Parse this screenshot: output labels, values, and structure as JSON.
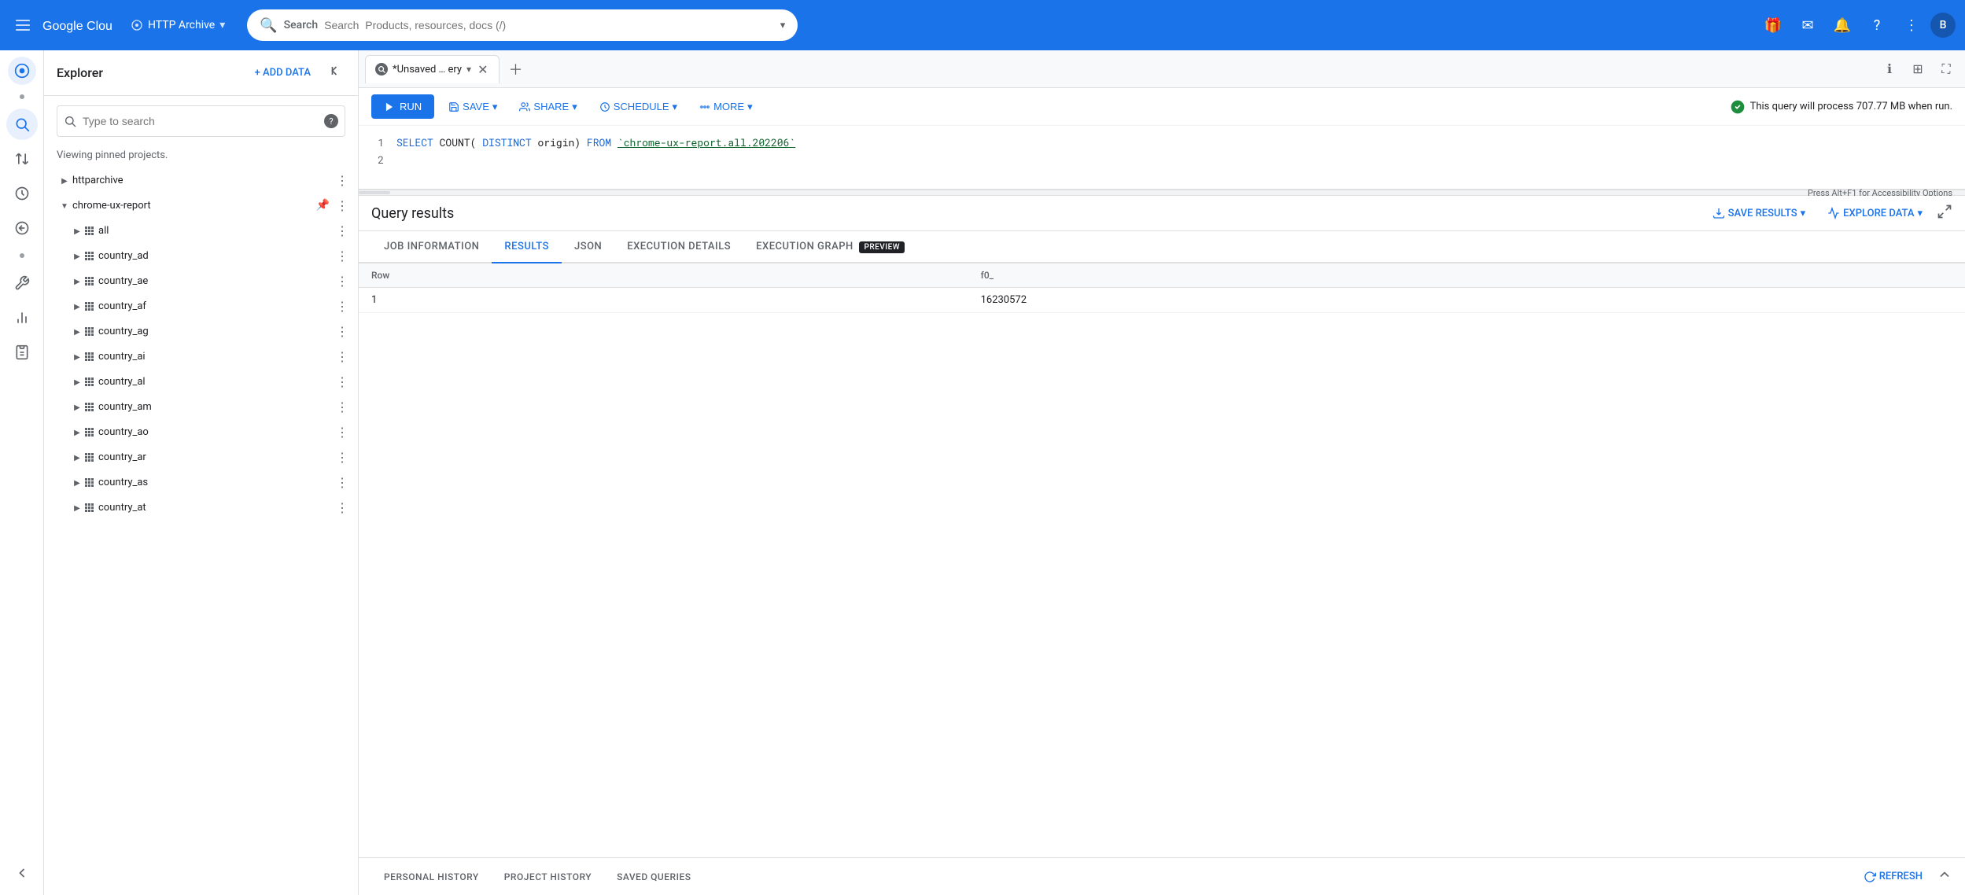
{
  "topnav": {
    "hamburger_label": "☰",
    "logo_text": "Google Cloud",
    "project_name": "HTTP Archive",
    "search_placeholder": "Search  Products, resources, docs (/)",
    "icons": [
      "🎁",
      "✉",
      "🔔",
      "?",
      "⋮"
    ],
    "avatar_letter": "B"
  },
  "icon_sidebar": {
    "items": [
      {
        "icon": "⊙",
        "name": "analytics-icon",
        "active": true
      },
      {
        "icon": "⇅",
        "name": "transfer-icon",
        "active": false
      },
      {
        "icon": "🕐",
        "name": "history-icon",
        "active": false
      },
      {
        "icon": "⚙",
        "name": "refresh-icon2",
        "active": false
      },
      {
        "icon": "🔧",
        "name": "tools-icon",
        "active": false
      },
      {
        "icon": "📊",
        "name": "chart-icon",
        "active": false
      },
      {
        "icon": "📋",
        "name": "clipboard-icon",
        "active": false
      }
    ],
    "expand_label": "‹"
  },
  "explorer": {
    "title": "Explorer",
    "add_data_label": "+ ADD DATA",
    "collapse_icon": "◁",
    "search_placeholder": "Type to search",
    "search_help": "?",
    "viewing_text": "Viewing pinned projects.",
    "tree": [
      {
        "id": "httparchive",
        "label": "httparchive",
        "level": 0,
        "expanded": false,
        "has_children": true,
        "pinned": false
      },
      {
        "id": "chrome-ux-report",
        "label": "chrome-ux-report",
        "level": 0,
        "expanded": true,
        "has_children": true,
        "pinned": true
      },
      {
        "id": "all",
        "label": "all",
        "level": 1,
        "expanded": false,
        "has_children": true,
        "pinned": false
      },
      {
        "id": "country_ad",
        "label": "country_ad",
        "level": 1,
        "expanded": false,
        "has_children": true,
        "pinned": false
      },
      {
        "id": "country_ae",
        "label": "country_ae",
        "level": 1,
        "expanded": false,
        "has_children": true,
        "pinned": false
      },
      {
        "id": "country_af",
        "label": "country_af",
        "level": 1,
        "expanded": false,
        "has_children": true,
        "pinned": false
      },
      {
        "id": "country_ag",
        "label": "country_ag",
        "level": 1,
        "expanded": false,
        "has_children": true,
        "pinned": false
      },
      {
        "id": "country_ai",
        "label": "country_ai",
        "level": 1,
        "expanded": false,
        "has_children": true,
        "pinned": false
      },
      {
        "id": "country_al",
        "label": "country_al",
        "level": 1,
        "expanded": false,
        "has_children": true,
        "pinned": false
      },
      {
        "id": "country_am",
        "label": "country_am",
        "level": 1,
        "expanded": false,
        "has_children": true,
        "pinned": false
      },
      {
        "id": "country_ao",
        "label": "country_ao",
        "level": 1,
        "expanded": false,
        "has_children": true,
        "pinned": false
      },
      {
        "id": "country_ar",
        "label": "country_ar",
        "level": 1,
        "expanded": false,
        "has_children": true,
        "pinned": false
      },
      {
        "id": "country_as",
        "label": "country_as",
        "level": 1,
        "expanded": false,
        "has_children": true,
        "pinned": false
      },
      {
        "id": "country_at",
        "label": "country_at",
        "level": 1,
        "expanded": false,
        "has_children": true,
        "pinned": false
      }
    ]
  },
  "tab_bar": {
    "tabs": [
      {
        "id": "unsaved",
        "label": "*Unsaved … ery",
        "active": true,
        "closable": true
      }
    ],
    "add_tab_label": "+",
    "actions": {
      "info": "ℹ",
      "table": "⊞",
      "expand": "⛶"
    }
  },
  "toolbar": {
    "run_label": "RUN",
    "run_icon": "▶",
    "save_label": "SAVE",
    "save_dropdown": "▾",
    "share_label": "SHARE",
    "share_dropdown": "▾",
    "schedule_label": "SCHEDULE",
    "schedule_dropdown": "▾",
    "more_label": "MORE",
    "more_dropdown": "▾",
    "notice": "This query will process 707.77 MB when run.",
    "notice_icon": "✓"
  },
  "code_editor": {
    "lines": [
      {
        "num": "1",
        "content": "SELECT COUNT(DISTINCT origin) FROM `chrome-ux-report.all.202206`"
      },
      {
        "num": "2",
        "content": ""
      }
    ]
  },
  "resize": {
    "hint": "Press Alt+F1 for Accessibility Options"
  },
  "results": {
    "title": "Query results",
    "save_results_label": "SAVE RESULTS",
    "explore_data_label": "EXPLORE DATA",
    "tabs": [
      {
        "id": "job-info",
        "label": "JOB INFORMATION",
        "active": false
      },
      {
        "id": "results",
        "label": "RESULTS",
        "active": true
      },
      {
        "id": "json",
        "label": "JSON",
        "active": false
      },
      {
        "id": "execution-details",
        "label": "EXECUTION DETAILS",
        "active": false
      },
      {
        "id": "execution-graph",
        "label": "EXECUTION GRAPH",
        "active": false,
        "badge": "PREVIEW"
      }
    ],
    "table": {
      "columns": [
        "Row",
        "f0_"
      ],
      "rows": [
        {
          "row": "1",
          "f0_": "16230572"
        }
      ]
    }
  },
  "bottom_bar": {
    "tabs": [
      {
        "id": "personal-history",
        "label": "PERSONAL HISTORY"
      },
      {
        "id": "project-history",
        "label": "PROJECT HISTORY"
      },
      {
        "id": "saved-queries",
        "label": "SAVED QUERIES"
      }
    ],
    "refresh_label": "REFRESH",
    "collapse_icon": "∧"
  }
}
